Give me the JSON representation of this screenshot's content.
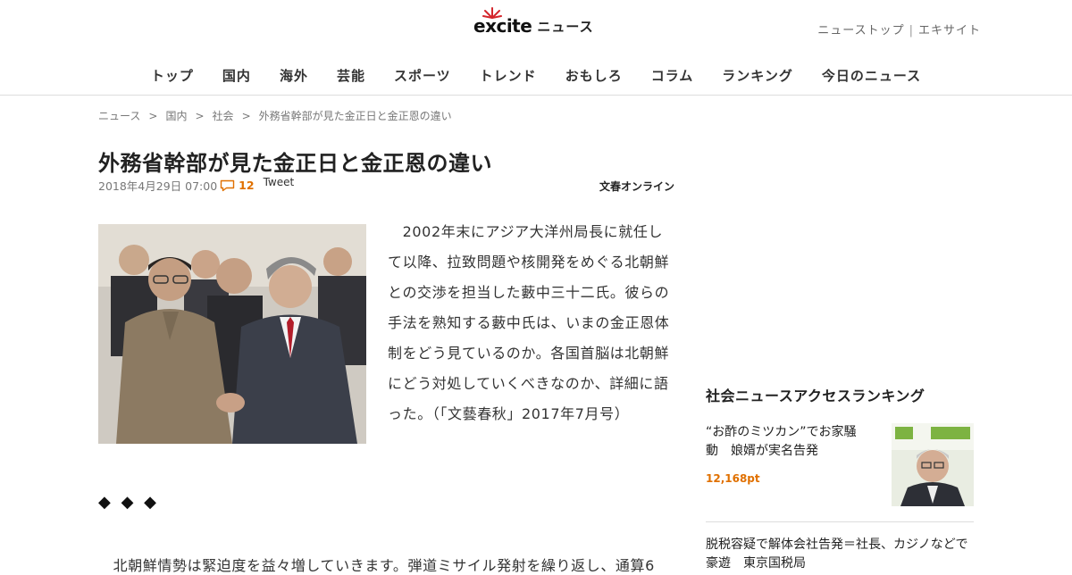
{
  "header": {
    "logo_text": "excite",
    "logo_suffix": "ニュース",
    "top_links": [
      "ニューストップ",
      "エキサイト"
    ],
    "nav": [
      "トップ",
      "国内",
      "海外",
      "芸能",
      "スポーツ",
      "トレンド",
      "おもしろ",
      "コラム",
      "ランキング",
      "今日のニュース"
    ]
  },
  "breadcrumb": [
    "ニュース",
    "国内",
    "社会",
    "外務省幹部が見た金正日と金正恩の違い"
  ],
  "article": {
    "title": "外務省幹部が見た金正日と金正恩の違い",
    "date": "2018年4月29日 07:00",
    "comment_count": "12",
    "tweet_label": "Tweet",
    "source": "文春オンライン",
    "lead": "　2002年末にアジア大洋州局長に就任して以降、拉致問題や核開発をめぐる北朝鮮との交渉を担当した藪中三十二氏。彼らの手法を熟知する藪中氏は、いまの金正恩体制をどう見ているのか。各国首脳は北朝鮮にどう対処していくべきなのか、詳細に語った。（「文藝春秋」2017年7月号）",
    "separator": "◆ ◆ ◆",
    "body_partial": "　北朝鮮情勢は緊迫度を益々増していきます。弾道ミサイル発射を繰り返し、通算6"
  },
  "sidebar": {
    "ranking_heading": "社会ニュースアクセスランキング",
    "items": [
      {
        "title": "“お酢のミツカン”でお家騒動　娘婿が実名告発",
        "points": "12,168pt"
      },
      {
        "title": "脱税容疑で解体会社告発＝社長、カジノなどで豪遊　東京国税局"
      }
    ]
  },
  "colors": {
    "accent_orange": "#e07000",
    "logo_red": "#d4262c"
  }
}
